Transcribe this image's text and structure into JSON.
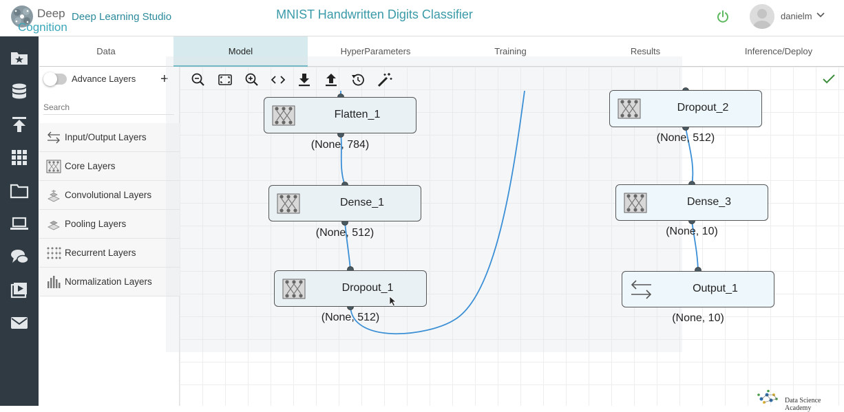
{
  "brand": {
    "word1": "Deep",
    "word2": "Cognition",
    "studio": "Deep Learning Studio"
  },
  "project": {
    "title": "MNIST Handwritten Digits Classifier"
  },
  "user": {
    "name": "danielm"
  },
  "colors": {
    "accent": "#3aa6b9",
    "rail": "#303a42",
    "tab_active": "#d7ebee",
    "wire": "#3a8fd6",
    "power": "#5cb85c",
    "check": "#3c8d3c"
  },
  "rail_icons": [
    "star-folder-icon",
    "database-icon",
    "upload-icon",
    "grid-icon",
    "folder-icon",
    "laptop-icon",
    "chat-icon",
    "video-icon",
    "mail-icon"
  ],
  "tabs": [
    {
      "label": "Data"
    },
    {
      "label": "Model"
    },
    {
      "label": "HyperParameters"
    },
    {
      "label": "Training"
    },
    {
      "label": "Results"
    },
    {
      "label": "Inference/Deploy"
    }
  ],
  "panel": {
    "advance_label": "Advance Layers",
    "search_placeholder": "Search",
    "layers": [
      {
        "label": "Input/Output Layers",
        "icon": "arrows-icon"
      },
      {
        "label": "Core Layers",
        "icon": "core-layer-icon"
      },
      {
        "label": "Convolutional Layers",
        "icon": "conv-layer-icon"
      },
      {
        "label": "Pooling Layers",
        "icon": "pooling-layer-icon"
      },
      {
        "label": "Recurrent Layers",
        "icon": "recurrent-layer-icon"
      },
      {
        "label": "Normalization Layers",
        "icon": "normalization-layer-icon"
      }
    ]
  },
  "toolbar": [
    "zoom-out-icon",
    "fit-screen-icon",
    "zoom-in-icon",
    "code-icon",
    "download-icon",
    "upload-icon",
    "history-icon",
    "magic-wand-icon"
  ],
  "nodes": [
    {
      "name": "Flatten_1",
      "shape": "(None, 784)"
    },
    {
      "name": "Dense_1",
      "shape": "(None, 512)"
    },
    {
      "name": "Dropout_1",
      "shape": "(None, 512)"
    },
    {
      "name": "Dropout_2",
      "shape": "(None, 512)"
    },
    {
      "name": "Dense_3",
      "shape": "(None, 10)"
    },
    {
      "name": "Output_1",
      "shape": "(None, 10)"
    }
  ],
  "watermark": {
    "text": "Data Science Academy"
  }
}
